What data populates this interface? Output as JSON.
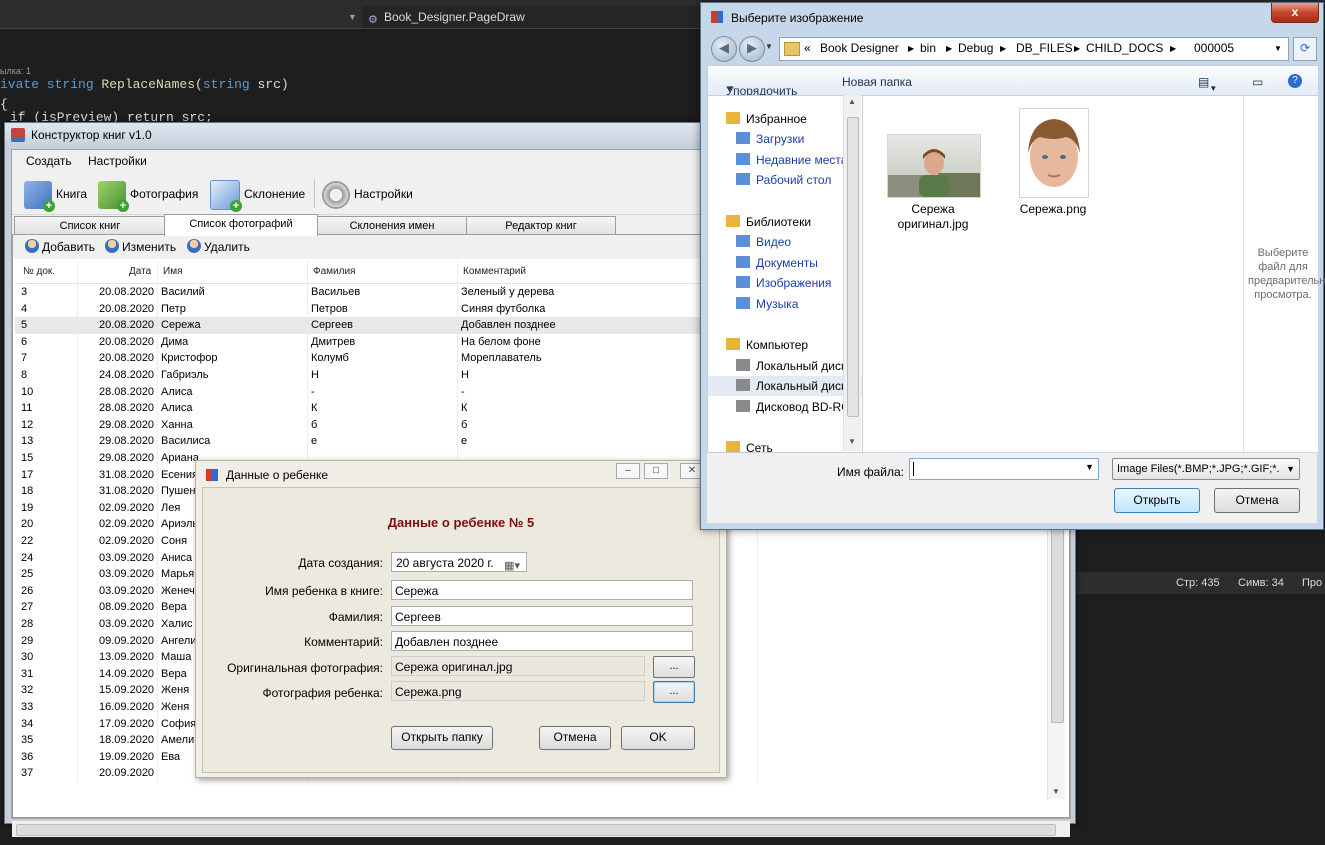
{
  "ide": {
    "document_dropdown": "Book_Designer.PageDraw",
    "hint": "ылка: 1",
    "code_line1_kw": "ivate string ",
    "code_line1_fn": "ReplaceNames",
    "code_line1_rest": "(",
    "code_line1_type": "string",
    "code_line1_end": " src)",
    "code_line2_brace": "{",
    "code_line3": "if (isPreview) return src;",
    "status_line": "Стр: 435",
    "status_col": "Симв: 34",
    "status_extra": "Про"
  },
  "main": {
    "title": "Конструктор книг v1.0",
    "menu": [
      "Создать",
      "Настройки"
    ],
    "toolbar": {
      "book": "Книга",
      "photo": "Фотография",
      "declension": "Склонение",
      "settings": "Настройки"
    },
    "tabs": [
      "Список книг",
      "Список фотографий",
      "Склонения имен",
      "Редактор книг"
    ],
    "actions": {
      "add": "Добавить",
      "edit": "Изменить",
      "delete": "Удалить"
    },
    "columns": [
      "№ док.",
      "Дата",
      "Имя",
      "Фамилия",
      "Комментарий"
    ],
    "rows": [
      [
        "3",
        "20.08.2020",
        "Василий",
        "Васильев",
        "Зеленый у дерева"
      ],
      [
        "4",
        "20.08.2020",
        "Петр",
        "Петров",
        "Синяя футболка"
      ],
      [
        "5",
        "20.08.2020",
        "Сережа",
        "Сергеев",
        "Добавлен позднее"
      ],
      [
        "6",
        "20.08.2020",
        "Дима",
        "Дмитрев",
        "На белом фоне"
      ],
      [
        "7",
        "20.08.2020",
        "Кристофор",
        "Колумб",
        "Мореплаватель"
      ],
      [
        "8",
        "24.08.2020",
        "Габриэль",
        "Н",
        "Н"
      ],
      [
        "10",
        "28.08.2020",
        "Алиса",
        "-",
        "-"
      ],
      [
        "11",
        "28.08.2020",
        "Алиса",
        "К",
        "К"
      ],
      [
        "12",
        "29.08.2020",
        "Ханна",
        "б",
        "б"
      ],
      [
        "13",
        "29.08.2020",
        "Василиса",
        "е",
        "е"
      ],
      [
        "15",
        "29.08.2020",
        "Ариана",
        "",
        ""
      ],
      [
        "17",
        "31.08.2020",
        "Есения",
        "",
        ""
      ],
      [
        "18",
        "31.08.2020",
        "Пушен",
        "",
        ""
      ],
      [
        "19",
        "02.09.2020",
        "Лея",
        "",
        ""
      ],
      [
        "20",
        "02.09.2020",
        "Ариэль",
        "",
        ""
      ],
      [
        "22",
        "02.09.2020",
        "Соня",
        "",
        ""
      ],
      [
        "24",
        "03.09.2020",
        "Аниса",
        "",
        ""
      ],
      [
        "25",
        "03.09.2020",
        "Марья",
        "",
        ""
      ],
      [
        "26",
        "03.09.2020",
        "Женеч",
        "",
        ""
      ],
      [
        "27",
        "08.09.2020",
        "Вера",
        "",
        ""
      ],
      [
        "28",
        "03.09.2020",
        "Халис",
        "",
        ""
      ],
      [
        "29",
        "09.09.2020",
        "Ангели",
        "",
        ""
      ],
      [
        "30",
        "13.09.2020",
        "Маша",
        "",
        ""
      ],
      [
        "31",
        "14.09.2020",
        "Вера",
        "",
        ""
      ],
      [
        "32",
        "15.09.2020",
        "Женя",
        "",
        ""
      ],
      [
        "33",
        "16.09.2020",
        "Женя",
        "",
        ""
      ],
      [
        "34",
        "17.09.2020",
        "София",
        "",
        ""
      ],
      [
        "35",
        "18.09.2020",
        "Амели",
        "",
        ""
      ],
      [
        "36",
        "19.09.2020",
        "Ева",
        "",
        ""
      ],
      [
        "37",
        "20.09.2020",
        "",
        "",
        ""
      ]
    ],
    "selected_row": 2
  },
  "child": {
    "title": "Данные о ребенке",
    "heading": "Данные о ребенке №  5",
    "labels": {
      "date": "Дата создания:",
      "name": "Имя ребенка в книге:",
      "surname": "Фамилия:",
      "comment": "Комментарий:",
      "original": "Оригинальная фотография:",
      "photo": "Фотография ребенка:"
    },
    "values": {
      "date": "20  августа  2020 г.",
      "name": "Сережа",
      "surname": "Сергеев",
      "comment": "Добавлен позднее",
      "original": "Сережа оригинал.jpg",
      "photo": "Сережа.png"
    },
    "browse": "...",
    "open_folder": "Открыть папку",
    "cancel": "Отмена",
    "ok": "OK"
  },
  "filedialog": {
    "title": "Выберите изображение",
    "path": [
      "«",
      "Book Designer",
      "bin",
      "Debug",
      "DB_FILES",
      "CHILD_DOCS",
      "000005"
    ],
    "organize": "Упорядочить",
    "new_folder": "Новая папка",
    "nav": [
      {
        "label": "Избранное",
        "style": "group"
      },
      {
        "label": "Загрузки",
        "style": "blue"
      },
      {
        "label": "Недавние места",
        "style": "blue"
      },
      {
        "label": "Рабочий стол",
        "style": "blue"
      },
      {
        "label": "Библиотеки",
        "style": "group"
      },
      {
        "label": "Видео",
        "style": "blue"
      },
      {
        "label": "Документы",
        "style": "blue"
      },
      {
        "label": "Изображения",
        "style": "blue"
      },
      {
        "label": "Музыка",
        "style": "blue"
      },
      {
        "label": "Компьютер",
        "style": "group"
      },
      {
        "label": "Локальный диск",
        "style": "plain"
      },
      {
        "label": "Локальный диск",
        "style": "plain"
      },
      {
        "label": "Дисковод BD-RO",
        "style": "plain"
      },
      {
        "label": "Сеть",
        "style": "group"
      }
    ],
    "files": [
      "Сережа оригинал.jpg",
      "Сережа.png"
    ],
    "preview_hint": "Выберите файл для предварительного просмотра.",
    "filename_label": "Имя файла:",
    "filename_value": "",
    "filter": "Image Files(*.BMP;*.JPG;*.GIF;*.",
    "open": "Открыть",
    "cancel": "Отмена",
    "close_glyph": "x"
  }
}
